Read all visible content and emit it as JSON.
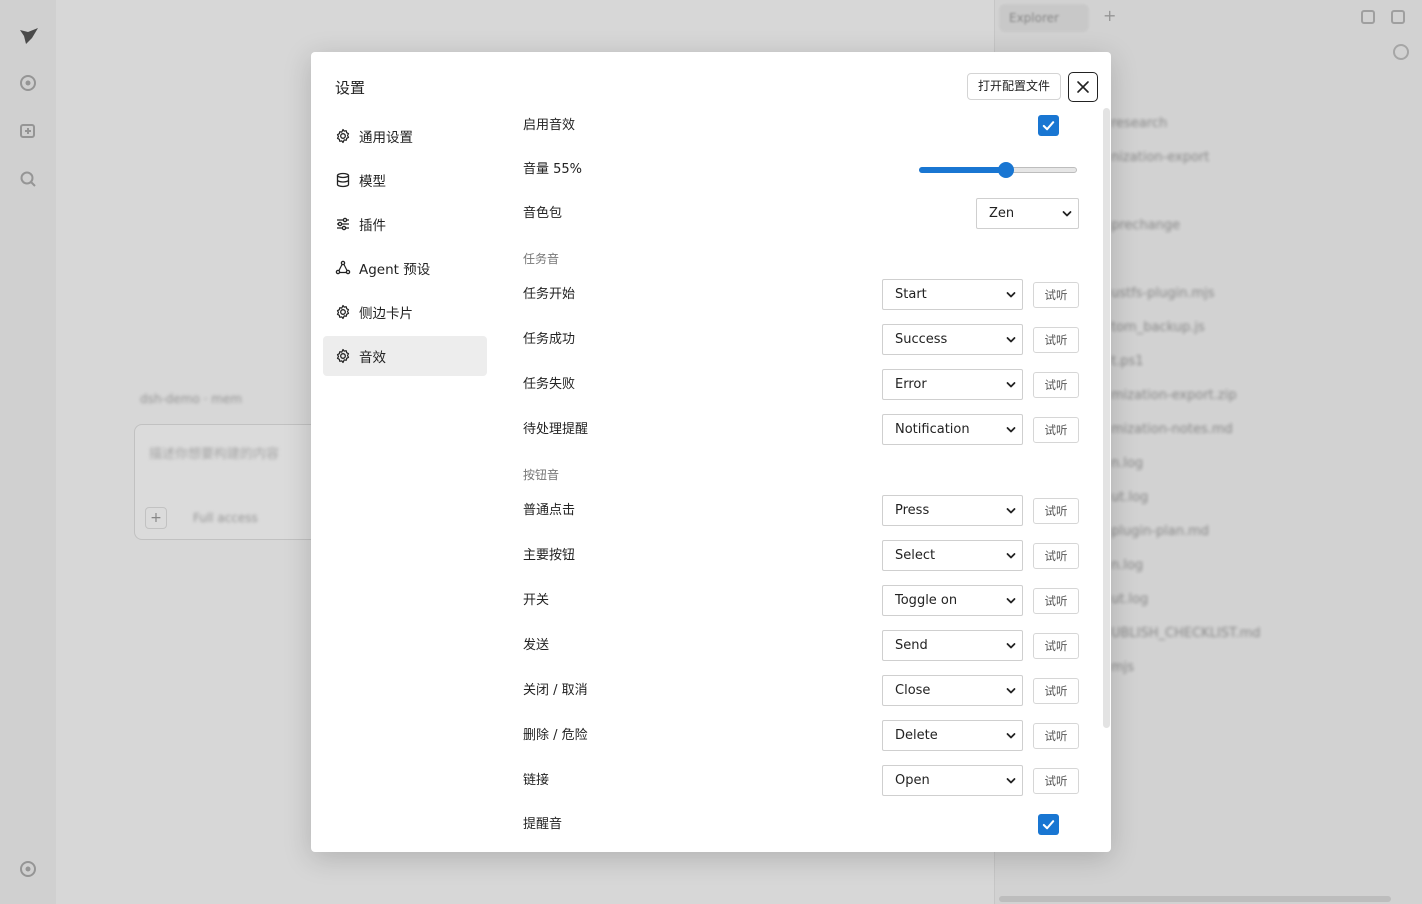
{
  "background": {
    "tags": "dsh-demo  ·  mem",
    "composer_placeholder": "描述你想要构建的内容",
    "access_label": "Full access",
    "explorer_tab": "Explorer",
    "files": [
      "research",
      "nization-export",
      "",
      "prechange",
      "",
      "ustfs-plugin.mjs",
      "tom_backup.js",
      "t.ps1",
      "mization-export.zip",
      "mization-notes.md",
      "n.log",
      "ut.log",
      "plugin-plan.md",
      "n.log",
      "ut.log",
      "UBLISH_CHECKLIST.md",
      "mjs"
    ]
  },
  "dialog": {
    "title": "设置",
    "open_config_label": "打开配置文件",
    "nav": [
      {
        "label": "通用设置",
        "icon": "gear-icon"
      },
      {
        "label": "模型",
        "icon": "database-icon"
      },
      {
        "label": "插件",
        "icon": "sliders-icon"
      },
      {
        "label": "Agent 预设",
        "icon": "agent-icon"
      },
      {
        "label": "侧边卡片",
        "icon": "gear-icon"
      },
      {
        "label": "音效",
        "icon": "gear-icon"
      }
    ],
    "active_nav": "音效",
    "sound": {
      "enable_label": "启用音效",
      "enable_checked": true,
      "volume_label": "音量 55%",
      "volume_fraction": 0.55,
      "pack_label": "音色包",
      "pack_value": "Zen",
      "task_section": "任务音",
      "task_rows": [
        {
          "label": "任务开始",
          "value": "Start",
          "try": "试听"
        },
        {
          "label": "任务成功",
          "value": "Success",
          "try": "试听"
        },
        {
          "label": "任务失败",
          "value": "Error",
          "try": "试听"
        },
        {
          "label": "待处理提醒",
          "value": "Notification",
          "try": "试听"
        }
      ],
      "button_section": "按钮音",
      "button_rows": [
        {
          "label": "普通点击",
          "value": "Press",
          "try": "试听"
        },
        {
          "label": "主要按钮",
          "value": "Select",
          "try": "试听"
        },
        {
          "label": "开关",
          "value": "Toggle on",
          "try": "试听"
        },
        {
          "label": "发送",
          "value": "Send",
          "try": "试听"
        },
        {
          "label": "关闭 / 取消",
          "value": "Close",
          "try": "试听"
        },
        {
          "label": "删除 / 危险",
          "value": "Delete",
          "try": "试听"
        },
        {
          "label": "链接",
          "value": "Open",
          "try": "试听"
        }
      ],
      "reminder_label": "提醒音",
      "reminder_checked": true
    }
  },
  "colors": {
    "accent": "#1976d2",
    "active_nav_bg": "#ededed"
  }
}
